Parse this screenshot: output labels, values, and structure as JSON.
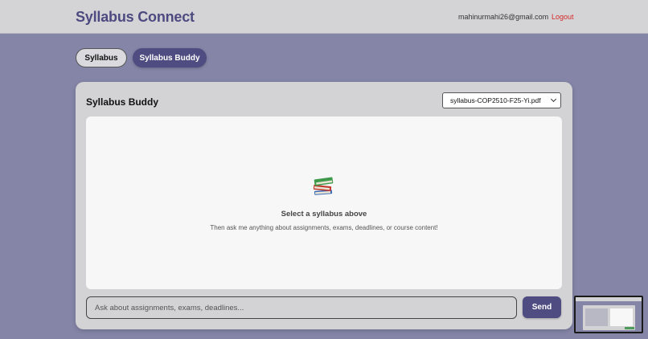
{
  "header": {
    "brand": "Syllabus Connect",
    "user_email": "mahinurmahi26@gmail.com",
    "logout_label": "Logout"
  },
  "tabs": [
    {
      "label": "Syllabus",
      "active": false
    },
    {
      "label": "Syllabus Buddy",
      "active": true
    }
  ],
  "buddy": {
    "title": "Syllabus Buddy",
    "selected_file": "syllabus-COP2510-F25-Yi.pdf",
    "empty_icon": "books-icon",
    "empty_title": "Select a syllabus above",
    "empty_subtitle": "Then ask me anything about assignments, exams, deadlines, or course content!",
    "input_placeholder": "Ask about assignments, exams, deadlines...",
    "input_value": "",
    "send_label": "Send"
  },
  "colors": {
    "background": "#8585a8",
    "brand": "#4c4a80",
    "accent": "#4e4c80",
    "logout": "#d62828"
  }
}
